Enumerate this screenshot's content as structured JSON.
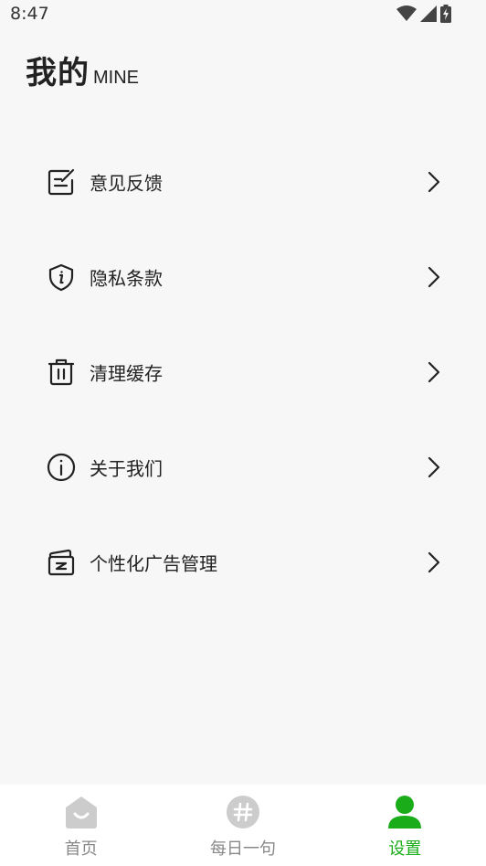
{
  "status_bar": {
    "time": "8:47",
    "icons": [
      "wifi-icon",
      "signal-icon",
      "battery-charging-icon"
    ]
  },
  "header": {
    "title": "我的",
    "subtitle": "MINE"
  },
  "menu": {
    "items": [
      {
        "label": "意见反馈",
        "icon": "feedback-icon"
      },
      {
        "label": "隐私条款",
        "icon": "privacy-shield-icon"
      },
      {
        "label": "清理缓存",
        "icon": "trash-icon"
      },
      {
        "label": "关于我们",
        "icon": "info-icon"
      },
      {
        "label": "个性化广告管理",
        "icon": "ad-cards-icon"
      }
    ],
    "chevron_icon": "chevron-right-icon"
  },
  "bottom_nav": {
    "tabs": [
      {
        "label": "首页",
        "icon": "home-icon",
        "active": false
      },
      {
        "label": "每日一句",
        "icon": "hashtag-icon",
        "active": false
      },
      {
        "label": "设置",
        "icon": "user-icon",
        "active": true
      }
    ]
  },
  "colors": {
    "background": "#f7f7f7",
    "text": "#222222",
    "accent_green": "#1aad19",
    "inactive_tab": "#888888",
    "inactive_icon": "#cccccc"
  }
}
